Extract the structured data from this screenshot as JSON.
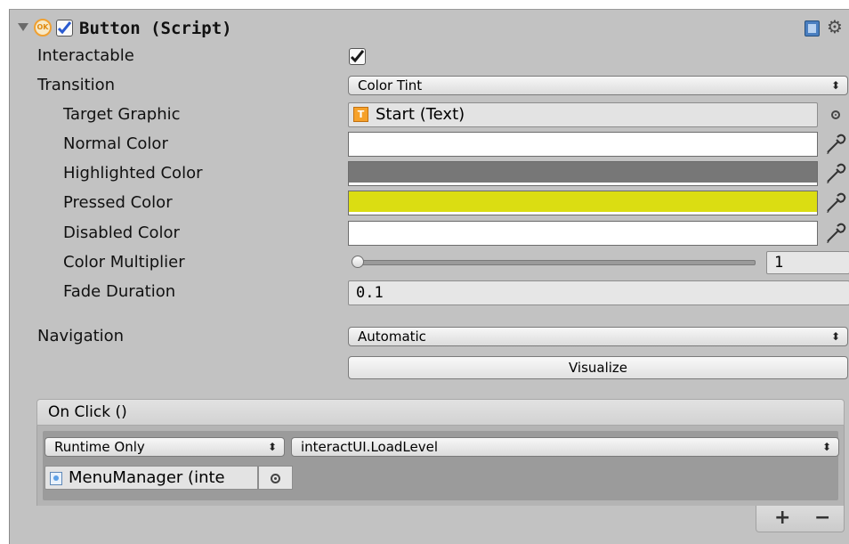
{
  "component": {
    "title": "Button (Script)",
    "enabled": true,
    "icon_text": "OK"
  },
  "fields": {
    "interactable": {
      "label": "Interactable",
      "checked": true
    },
    "transition": {
      "label": "Transition",
      "value": "Color Tint"
    },
    "target_graphic": {
      "label": "Target Graphic",
      "value": "Start (Text)",
      "icon_text": "T"
    },
    "normal_color": {
      "label": "Normal Color",
      "color": "#ffffff"
    },
    "highlighted_color": {
      "label": "Highlighted Color",
      "color": "#777777"
    },
    "pressed_color": {
      "label": "Pressed Color",
      "color": "#dbdd12"
    },
    "disabled_color": {
      "label": "Disabled Color",
      "color": "#ffffff"
    },
    "color_multiplier": {
      "label": "Color Multiplier",
      "value": "1",
      "slider_fraction": 0
    },
    "fade_duration": {
      "label": "Fade Duration",
      "value": "0.1"
    },
    "navigation": {
      "label": "Navigation",
      "value": "Automatic"
    },
    "visualize": {
      "label": "Visualize"
    }
  },
  "on_click": {
    "header": "On Click ()",
    "runtime": "Runtime Only",
    "function": "interactUI.LoadLevel",
    "object": "MenuManager (inte",
    "add_label": "+",
    "remove_label": "−"
  }
}
